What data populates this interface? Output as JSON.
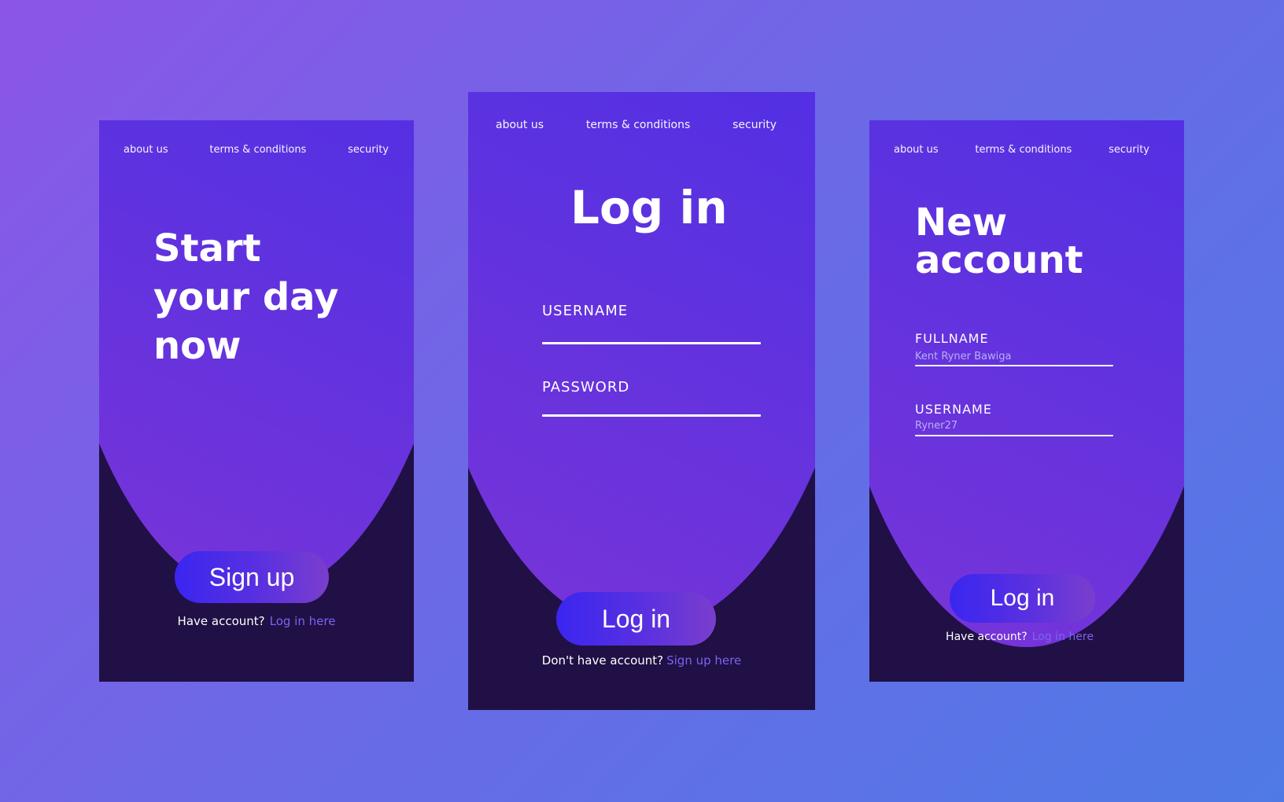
{
  "nav": {
    "about": "about us",
    "terms": "terms & conditions",
    "security": "security"
  },
  "signup_screen": {
    "heading_lines": [
      "Start",
      "your day",
      "now"
    ],
    "button": "Sign up",
    "footer_text": "Have account?",
    "footer_link": "Log in here"
  },
  "login_screen": {
    "heading": "Log in",
    "username_label": "USERNAME",
    "password_label": "PASSWORD",
    "button": "Log in",
    "footer_text": "Don't have account?",
    "footer_link": "Sign up here"
  },
  "new_account_screen": {
    "heading_lines": [
      "New",
      "account"
    ],
    "fullname_label": "FULLNAME",
    "fullname_value": "Kent Ryner Bawiga",
    "username_label": "USERNAME",
    "username_value": "Ryner27",
    "button": "Log in",
    "footer_text": "Have account?",
    "footer_link": "Log in here"
  },
  "colors": {
    "background_start": "#8b55e8",
    "background_end": "#4f7ae6",
    "card_dark": "#201045",
    "accent_blue": "#3d26ee",
    "link": "#7d63f0"
  }
}
